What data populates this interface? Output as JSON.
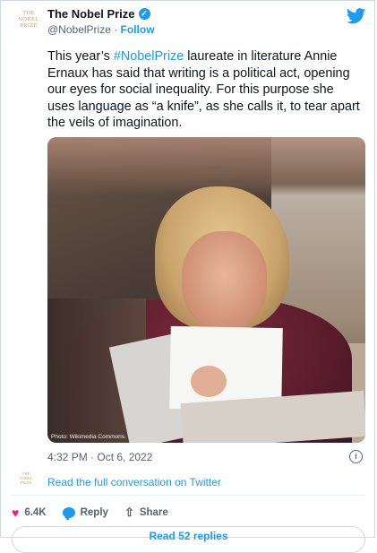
{
  "header": {
    "logo_lines": [
      "THE",
      "NOBEL",
      "PRIZE"
    ],
    "display_name": "The Nobel Prize",
    "handle": "@NobelPrize",
    "separator": " · ",
    "follow_label": "Follow",
    "verified_glyph": "✓"
  },
  "tweet": {
    "text_before": "This year’s ",
    "hashtag": "#NobelPrize",
    "text_after": " laureate in literature Annie Ernaux has said that writing is a political act, opening our eyes for social inequality. For this purpose she uses language as “a knife”, as she calls it, to tear apart the veils of imagination.",
    "photo_credit": "Photo: Wikimedia Commons.",
    "timestamp": "4:32 PM · Oct 6, 2022",
    "info_glyph": "i"
  },
  "conversation": {
    "logo_lines": [
      "THE",
      "NOBEL",
      "PRIZE"
    ],
    "link_label": "Read the full conversation on Twitter"
  },
  "actions": {
    "like_count": "6.4K",
    "reply_label": "Reply",
    "share_label": "Share",
    "like_glyph": "♥",
    "share_glyph": "⇧"
  },
  "footer": {
    "read_replies_label": "Read 52 replies"
  },
  "colors": {
    "accent": "#1d9bf0",
    "like": "#f91880",
    "brand_gold": "#c9a061",
    "muted": "#536471"
  }
}
